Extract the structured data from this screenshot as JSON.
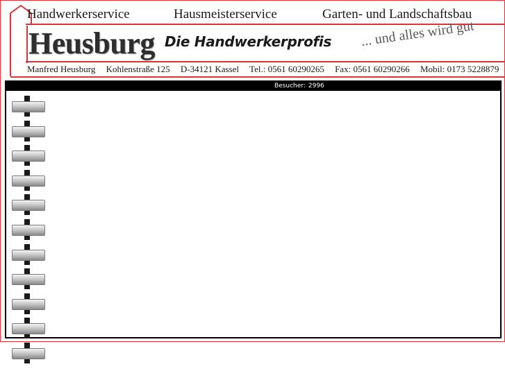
{
  "header": {
    "services": [
      "Handwerkerservice",
      "Hausmeisterservice",
      "Garten- und Landschaftsbau"
    ],
    "brand": "Heusburg",
    "tagline": "Die Handwerkerprofis",
    "slogan": "... und alles wird gut",
    "contact": {
      "name": "Manfred Heusburg",
      "street": "Kohlenstraße 125",
      "city": "D-34121 Kassel",
      "phone": "Tel.: 0561 60290265",
      "fax": "Fax: 0561 60290266",
      "mobile": "Mobil: 0173 5228879"
    }
  },
  "content": {
    "visitor_label": "Besucher:",
    "visitor_count": "2996"
  },
  "colors": {
    "accent_red": "#d8353a",
    "frame_black": "#000000"
  },
  "icons": [
    "house-outline-icon",
    "spiral-binding-icon"
  ]
}
